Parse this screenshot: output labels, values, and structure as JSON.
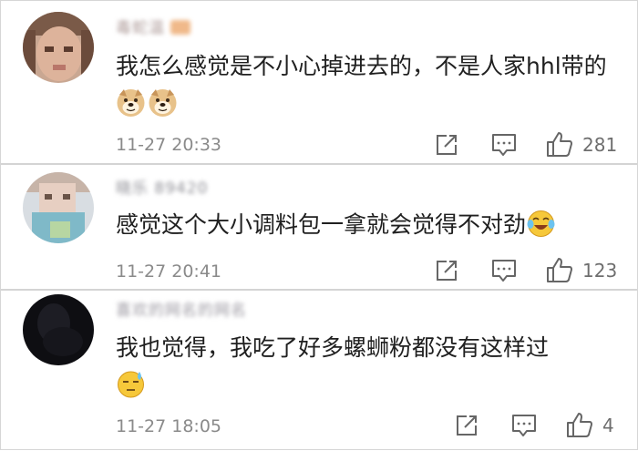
{
  "comments": [
    {
      "username": "毒蛇温",
      "text": "我怎么感觉是不小心掉进去的，不是人家hhl带的",
      "emojis": [
        "doge-emoji",
        "doge-emoji"
      ],
      "time": "11-27 20:33",
      "likes": "281"
    },
    {
      "username": "晓乐 89420",
      "text": "感觉这个大小调料包一拿就会觉得不对劲",
      "emojis": [
        "laugh-cry-emoji"
      ],
      "time": "11-27 20:41",
      "likes": "123"
    },
    {
      "username": "喜欢的网名的网名",
      "text": "我也觉得，我吃了好多螺蛳粉都没有这样过",
      "emojis": [
        "sweat-emoji"
      ],
      "time": "11-27 18:05",
      "likes": "4"
    }
  ],
  "colors": {
    "text": "#202020",
    "meta": "#8a8a8a",
    "icon": "#666666",
    "divider": "#d4d4d4"
  },
  "icons": {
    "share": "share-icon",
    "reply": "comment-icon",
    "like": "thumbs-up-icon"
  }
}
